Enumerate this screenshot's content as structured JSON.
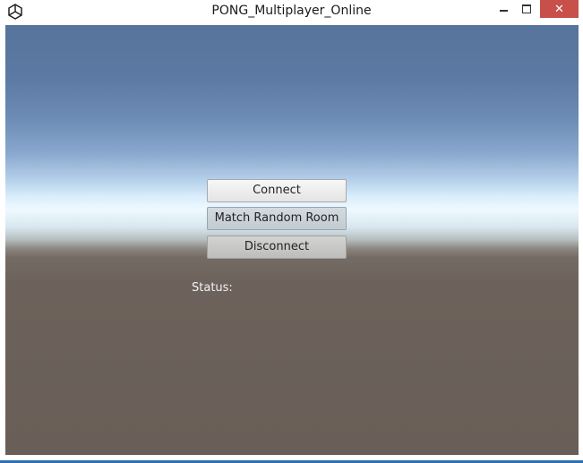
{
  "window": {
    "title": "PONG_Multiplayer_Online",
    "icon": "unity-icon",
    "controls": {
      "minimize_icon": "minimize-icon",
      "maximize_icon": "maximize-icon",
      "close_icon": "close-icon",
      "close_glyph": "✕"
    }
  },
  "game": {
    "buttons": {
      "connect_label": "Connect",
      "match_label": "Match Random Room",
      "disconnect_label": "Disconnect"
    },
    "status_label": "Status:"
  },
  "colors": {
    "close_button": "#c7504a",
    "sky_top": "#57749c",
    "horizon": "#eef9ff",
    "ground": "#695f58",
    "status_text": "#f2f2f2"
  }
}
